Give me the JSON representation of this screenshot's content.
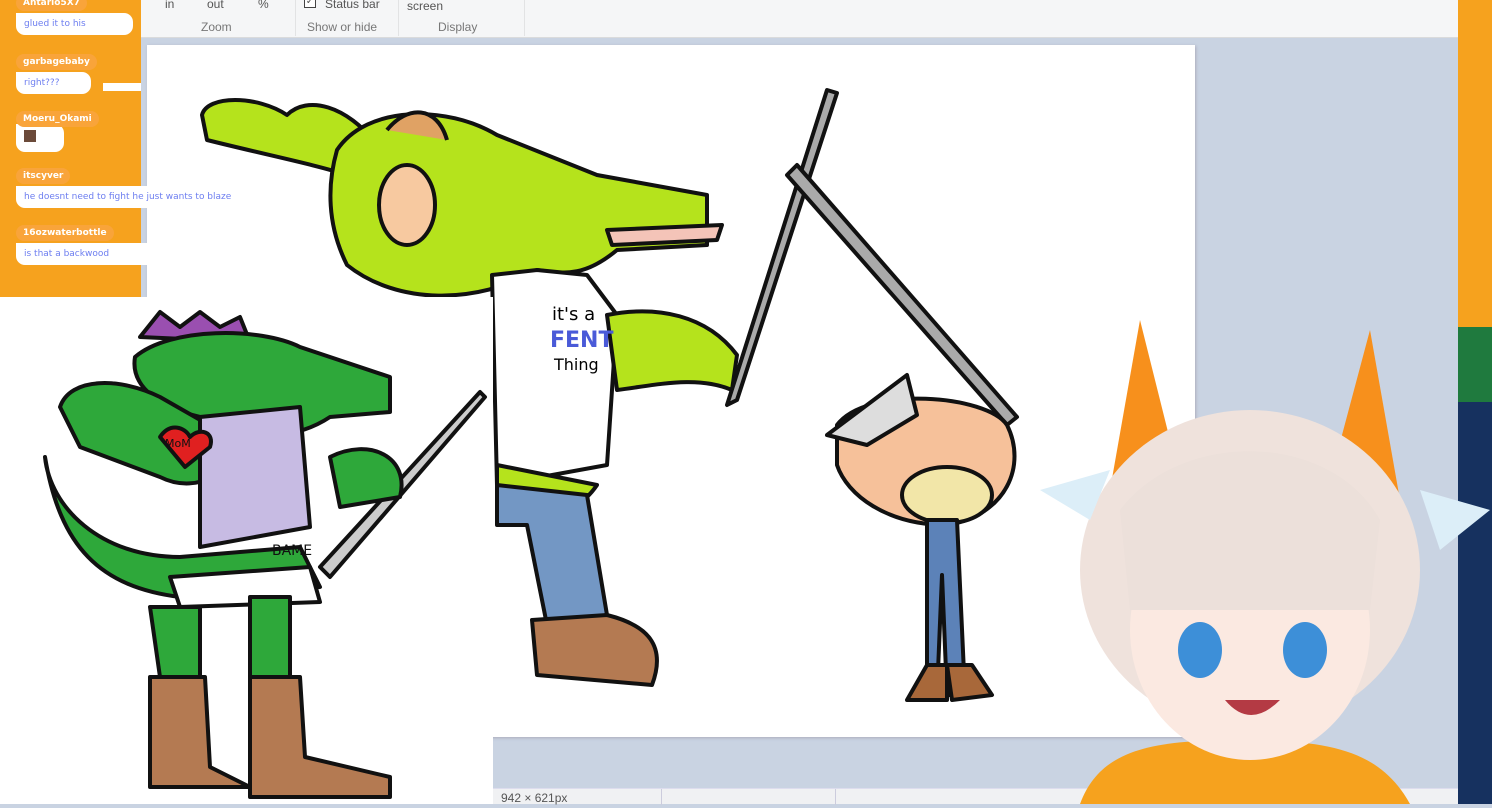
{
  "chat": [
    {
      "user": "Antario5X7",
      "text": "glued it to his"
    },
    {
      "user": "garbagebaby",
      "text": "right???"
    },
    {
      "user": "Moeru_Okami",
      "text": ""
    },
    {
      "user": "itscyver",
      "text": "he doesnt need to fight he just wants to blaze"
    },
    {
      "user": "16ozwaterbottle",
      "text": "is that a backwood"
    }
  ],
  "ribbon": {
    "zoom_in": "in",
    "zoom_out": "out",
    "zoom_pct": "%",
    "zoom_group": "Zoom",
    "status_bar": "Status bar",
    "show_hide_group": "Show or hide",
    "full_screen": "screen",
    "display_group": "Display"
  },
  "status": {
    "size": "942 × 621px"
  },
  "drawing": {
    "shirt_line1": "it's a",
    "shirt_line2": "FENT",
    "shirt_line3": "Thing",
    "heart": "MoM",
    "belt": "BAME"
  },
  "colors": {
    "chat_bg": "#f6a21e",
    "name_color": "#6d7ef0",
    "canvas_bg": "#c9d3e2"
  }
}
